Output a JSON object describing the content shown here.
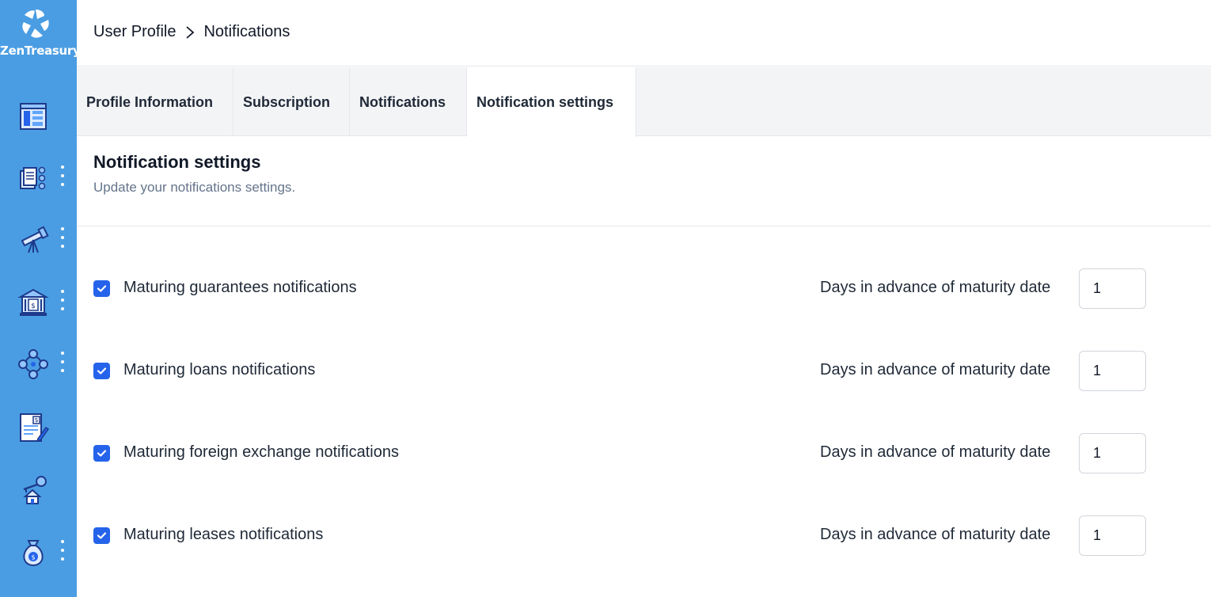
{
  "app": {
    "brand": "ZenTreasury",
    "brand_color": "#4a9de3",
    "accent_color": "#2563eb"
  },
  "sidebar": {
    "items": [
      {
        "icon": "dashboard-icon",
        "has_menu": false
      },
      {
        "icon": "documents-icon",
        "has_menu": true
      },
      {
        "icon": "telescope-icon",
        "has_menu": true
      },
      {
        "icon": "bank-icon",
        "has_menu": true
      },
      {
        "icon": "network-icon",
        "has_menu": true
      },
      {
        "icon": "invoice-icon",
        "has_menu": false
      },
      {
        "icon": "key-house-icon",
        "has_menu": false
      },
      {
        "icon": "money-bag-icon",
        "has_menu": true
      }
    ]
  },
  "header": {
    "breadcrumb": [
      "User Profile",
      "Notifications"
    ]
  },
  "tabs": [
    {
      "label": "Profile Information",
      "active": false
    },
    {
      "label": "Subscription",
      "active": false
    },
    {
      "label": "Notifications",
      "active": false
    },
    {
      "label": "Notification settings",
      "active": true
    }
  ],
  "section": {
    "title": "Notification settings",
    "subtitle": "Update your notifications settings."
  },
  "settings": [
    {
      "label": "Maturing guarantees notifications",
      "checked": true,
      "days_label": "Days in advance of maturity date",
      "days_value": "1"
    },
    {
      "label": "Maturing loans notifications",
      "checked": true,
      "days_label": "Days in advance of maturity date",
      "days_value": "1"
    },
    {
      "label": "Maturing foreign exchange notifications",
      "checked": true,
      "days_label": "Days in advance of maturity date",
      "days_value": "1"
    },
    {
      "label": "Maturing leases notifications",
      "checked": true,
      "days_label": "Days in advance of maturity date",
      "days_value": "1"
    }
  ]
}
